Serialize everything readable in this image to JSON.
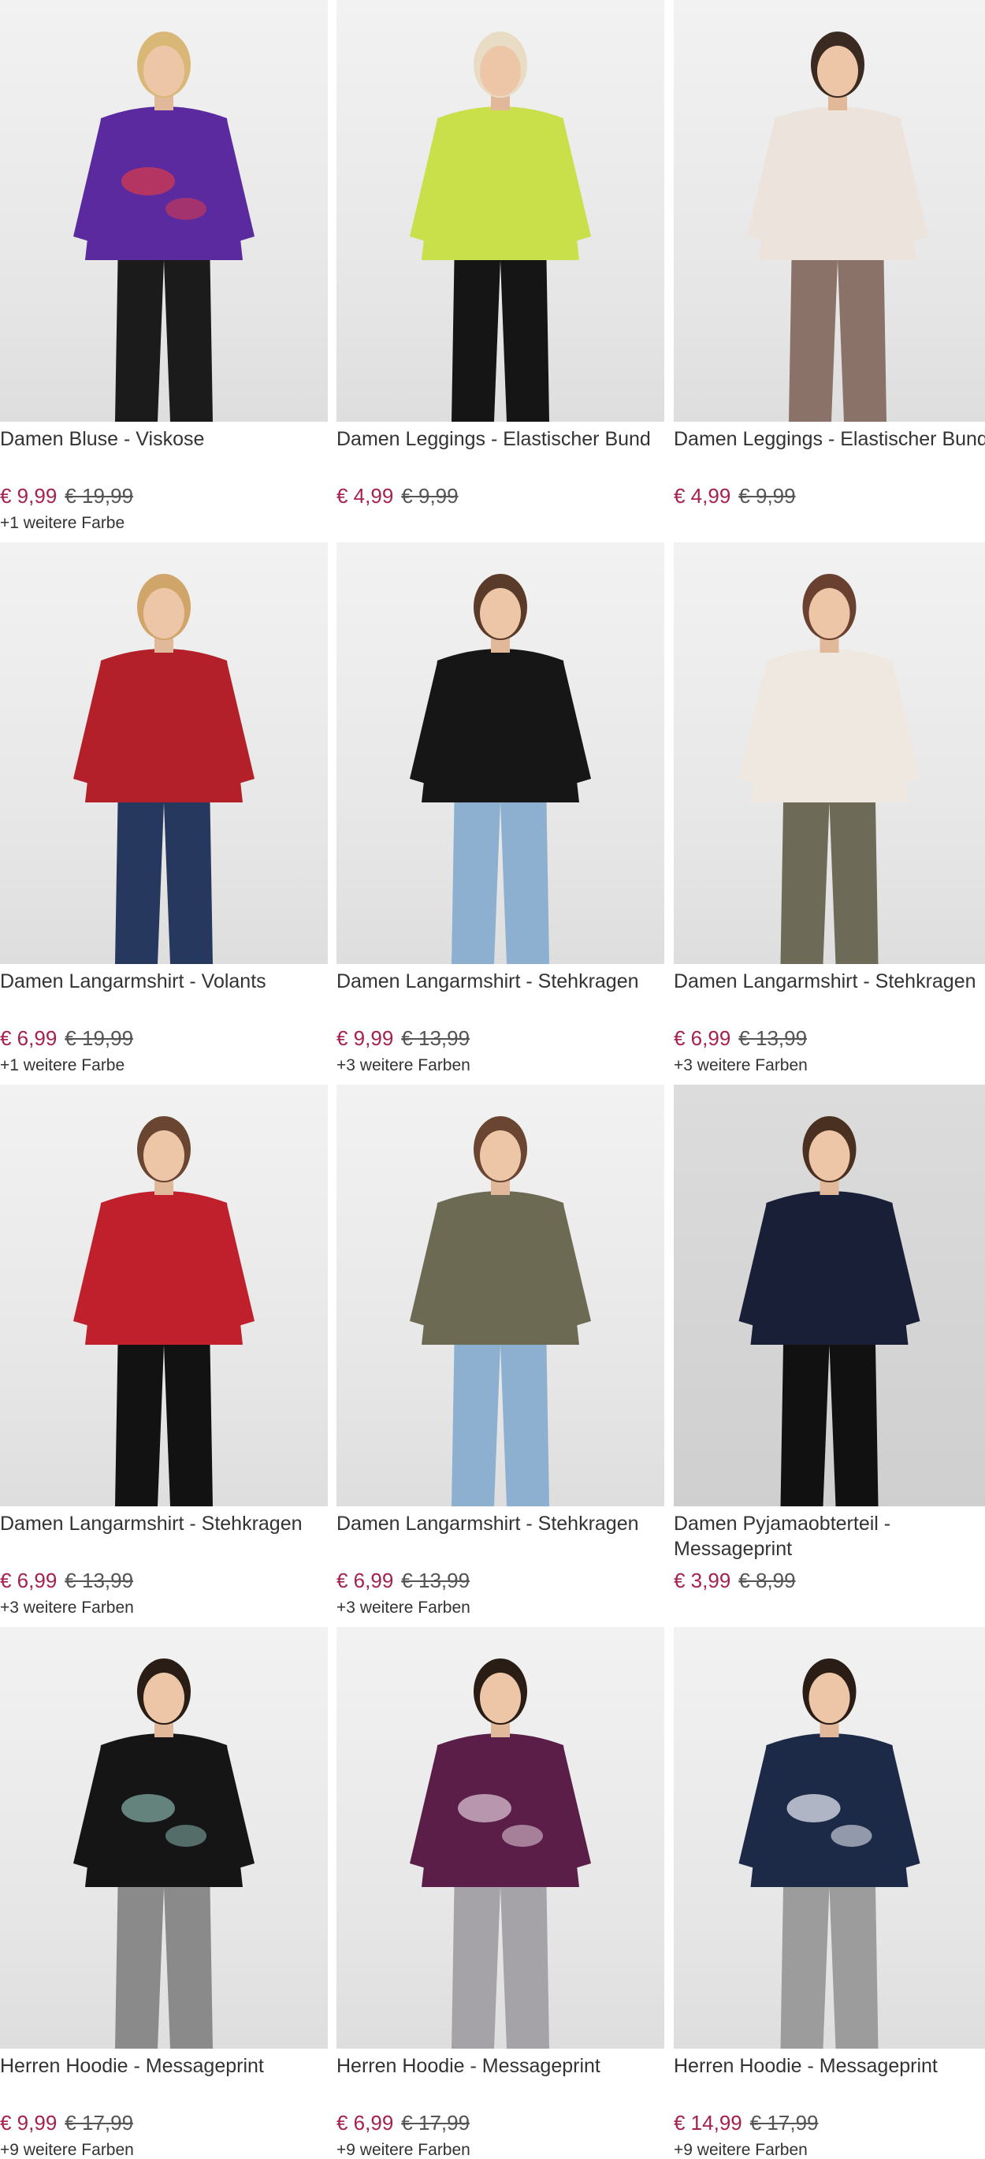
{
  "products": [
    {
      "title": "Damen Bluse - Viskose",
      "price": "€ 9,99",
      "old_price": "€ 19,99",
      "colors": "+1 weitere Farbe",
      "top": "#5b2a9e",
      "pattern": "#d23a4e",
      "bottom": "#1b1b1b",
      "hair": "#d9b777"
    },
    {
      "title": "Damen Leggings - Elastischer Bund",
      "price": "€ 4,99",
      "old_price": "€ 9,99",
      "colors": "",
      "top": "#c9e04a",
      "pattern": "",
      "bottom": "#151515",
      "hair": "#e8dcc4"
    },
    {
      "title": "Damen Leggings - Elastischer Bund",
      "price": "€ 4,99",
      "old_price": "€ 9,99",
      "colors": "",
      "top": "#ece4dc",
      "pattern": "",
      "bottom": "#8a7268",
      "hair": "#3a2a22"
    },
    {
      "title": "Damen Langarmshirt - Volants",
      "price": "€ 6,99",
      "old_price": "€ 19,99",
      "colors": "+1 weitere Farbe",
      "top": "#b3202a",
      "pattern": "",
      "bottom": "#27385e",
      "hair": "#cfa56a"
    },
    {
      "title": "Damen Langarmshirt - Stehkragen",
      "price": "€ 9,99",
      "old_price": "€ 13,99",
      "colors": "+3 weitere Farben",
      "top": "#161616",
      "pattern": "",
      "bottom": "#8db0d0",
      "hair": "#5a3a28"
    },
    {
      "title": "Damen Langarmshirt - Stehkragen",
      "price": "€ 6,99",
      "old_price": "€ 13,99",
      "colors": "+3 weitere Farben",
      "top": "#efe8e0",
      "pattern": "",
      "bottom": "#6e6a58",
      "hair": "#6a4030"
    },
    {
      "title": "Damen Langarmshirt - Stehkragen",
      "price": "€ 6,99",
      "old_price": "€ 13,99",
      "colors": "+3 weitere Farben",
      "top": "#c0202c",
      "pattern": "",
      "bottom": "#121212",
      "hair": "#6a4632"
    },
    {
      "title": "Damen Langarmshirt - Stehkragen",
      "price": "€ 6,99",
      "old_price": "€ 13,99",
      "colors": "+3 weitere Farben",
      "top": "#6c6a52",
      "pattern": "",
      "bottom": "#8db0d0",
      "hair": "#6a4632"
    },
    {
      "title": "Damen Pyjamaobterteil - Messageprint",
      "price": "€ 3,99",
      "old_price": "€ 8,99",
      "colors": "",
      "top": "#1a1f38",
      "pattern": "",
      "bottom": "#111111",
      "hair": "#4a3020"
    },
    {
      "title": "Herren Hoodie - Messageprint",
      "price": "€ 9,99",
      "old_price": "€ 17,99",
      "colors": "+9 weitere Farben",
      "top": "#151515",
      "pattern": "#7fa8a0",
      "bottom": "#8a8a8a",
      "hair": "#2a1d16"
    },
    {
      "title": "Herren Hoodie - Messageprint",
      "price": "€ 6,99",
      "old_price": "€ 17,99",
      "colors": "+9 weitere Farben",
      "top": "#5a1e48",
      "pattern": "#d8c0d0",
      "bottom": "#a6a3a8",
      "hair": "#2a1d16"
    },
    {
      "title": "Herren Hoodie - Messageprint",
      "price": "€ 14,99",
      "old_price": "€ 17,99",
      "colors": "+9 weitere Farben",
      "top": "#1c2a48",
      "pattern": "#e0e4ee",
      "bottom": "#9c9c9c",
      "hair": "#2a1d16"
    }
  ]
}
